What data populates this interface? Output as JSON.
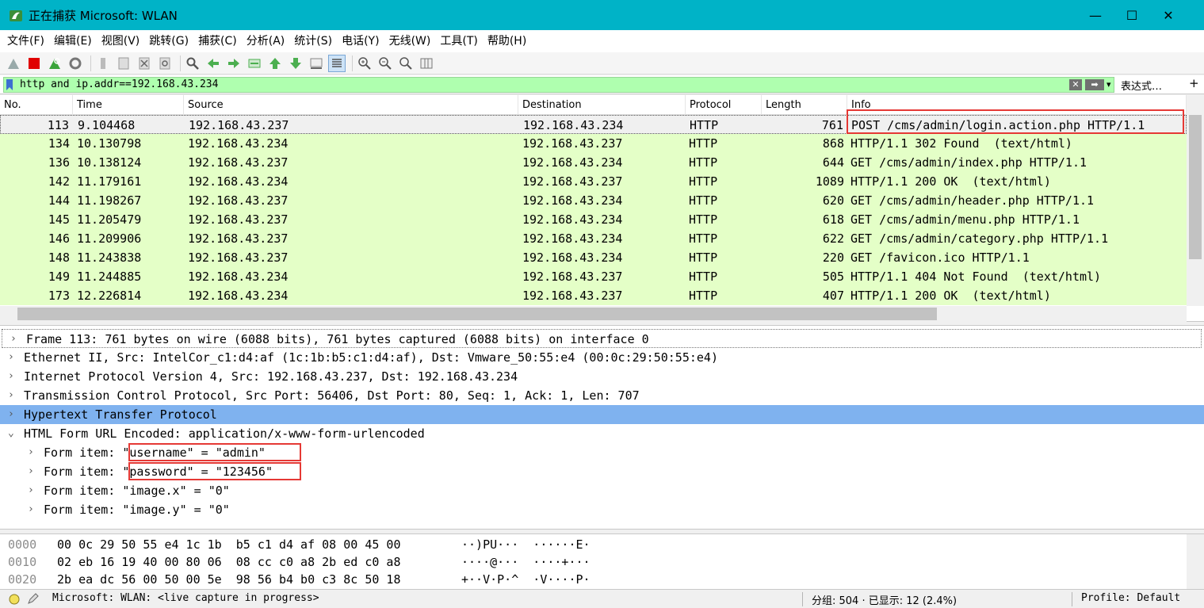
{
  "window": {
    "title": "正在捕获 Microsoft: WLAN",
    "minimize_glyph": "—",
    "maximize_glyph": "☐",
    "close_glyph": "✕"
  },
  "menu": {
    "items": [
      "文件(F)",
      "编辑(E)",
      "视图(V)",
      "跳转(G)",
      "捕获(C)",
      "分析(A)",
      "统计(S)",
      "电话(Y)",
      "无线(W)",
      "工具(T)",
      "帮助(H)"
    ]
  },
  "toolbar": {
    "icons": [
      "shark-fin-start-icon",
      "stop-capture-icon",
      "restart-capture-icon",
      "capture-options-icon",
      "open-file-icon",
      "save-file-icon",
      "close-file-icon",
      "reload-icon",
      "find-packet-icon",
      "go-back-icon",
      "go-forward-icon",
      "go-to-packet-icon",
      "first-packet-icon",
      "last-packet-icon",
      "autoscroll-icon",
      "colorize-icon",
      "zoom-in-icon",
      "zoom-out-icon",
      "normal-size-icon",
      "resize-columns-icon"
    ]
  },
  "filter": {
    "value": "http and ip.addr==192.168.43.234",
    "expression_label": "表达式…",
    "add_label": "+",
    "clear_glyph": "✕",
    "apply_glyph": "➡",
    "dropdown_glyph": "▾"
  },
  "packet_list": {
    "columns": [
      "No.",
      "Time",
      "Source",
      "Destination",
      "Protocol",
      "Length",
      "Info"
    ],
    "rows": [
      {
        "no": "113",
        "time": "9.104468",
        "src": "192.168.43.237",
        "dst": "192.168.43.234",
        "proto": "HTTP",
        "len": "761",
        "info": "POST /cms/admin/login.action.php HTTP/1.1",
        "selected": true
      },
      {
        "no": "134",
        "time": "10.130798",
        "src": "192.168.43.234",
        "dst": "192.168.43.237",
        "proto": "HTTP",
        "len": "868",
        "info": "HTTP/1.1 302 Found  (text/html)"
      },
      {
        "no": "136",
        "time": "10.138124",
        "src": "192.168.43.237",
        "dst": "192.168.43.234",
        "proto": "HTTP",
        "len": "644",
        "info": "GET /cms/admin/index.php HTTP/1.1"
      },
      {
        "no": "142",
        "time": "11.179161",
        "src": "192.168.43.234",
        "dst": "192.168.43.237",
        "proto": "HTTP",
        "len": "1089",
        "info": "HTTP/1.1 200 OK  (text/html)"
      },
      {
        "no": "144",
        "time": "11.198267",
        "src": "192.168.43.237",
        "dst": "192.168.43.234",
        "proto": "HTTP",
        "len": "620",
        "info": "GET /cms/admin/header.php HTTP/1.1"
      },
      {
        "no": "145",
        "time": "11.205479",
        "src": "192.168.43.237",
        "dst": "192.168.43.234",
        "proto": "HTTP",
        "len": "618",
        "info": "GET /cms/admin/menu.php HTTP/1.1"
      },
      {
        "no": "146",
        "time": "11.209906",
        "src": "192.168.43.237",
        "dst": "192.168.43.234",
        "proto": "HTTP",
        "len": "622",
        "info": "GET /cms/admin/category.php HTTP/1.1"
      },
      {
        "no": "148",
        "time": "11.243838",
        "src": "192.168.43.237",
        "dst": "192.168.43.234",
        "proto": "HTTP",
        "len": "220",
        "info": "GET /favicon.ico HTTP/1.1"
      },
      {
        "no": "149",
        "time": "11.244885",
        "src": "192.168.43.234",
        "dst": "192.168.43.237",
        "proto": "HTTP",
        "len": "505",
        "info": "HTTP/1.1 404 Not Found  (text/html)"
      },
      {
        "no": "173",
        "time": "12.226814",
        "src": "192.168.43.234",
        "dst": "192.168.43.237",
        "proto": "HTTP",
        "len": "407",
        "info": "HTTP/1.1 200 OK  (text/html)"
      }
    ]
  },
  "details": {
    "rows": [
      {
        "arrow": "›",
        "text": "Frame 113: 761 bytes on wire (6088 bits), 761 bytes captured (6088 bits) on interface 0",
        "indent": 0
      },
      {
        "arrow": "›",
        "text": "Ethernet II, Src: IntelCor_c1:d4:af (1c:1b:b5:c1:d4:af), Dst: Vmware_50:55:e4 (00:0c:29:50:55:e4)",
        "indent": 0
      },
      {
        "arrow": "›",
        "text": "Internet Protocol Version 4, Src: 192.168.43.237, Dst: 192.168.43.234",
        "indent": 0
      },
      {
        "arrow": "›",
        "text": "Transmission Control Protocol, Src Port: 56406, Dst Port: 80, Seq: 1, Ack: 1, Len: 707",
        "indent": 0
      },
      {
        "arrow": "›",
        "text": "Hypertext Transfer Protocol",
        "indent": 0,
        "selected": true
      },
      {
        "arrow": "⌄",
        "text": "HTML Form URL Encoded: application/x-www-form-urlencoded",
        "indent": 0
      },
      {
        "arrow": "›",
        "text": "Form item: \"username\" = \"admin\"",
        "indent": 1
      },
      {
        "arrow": "›",
        "text": "Form item: \"password\" = \"123456\"",
        "indent": 1
      },
      {
        "arrow": "›",
        "text": "Form item: \"image.x\" = \"0\"",
        "indent": 1
      },
      {
        "arrow": "›",
        "text": "Form item: \"image.y\" = \"0\"",
        "indent": 1
      }
    ]
  },
  "bytes": {
    "rows": [
      {
        "offset": "0000",
        "hex": "00 0c 29 50 55 e4 1c 1b  b5 c1 d4 af 08 00 45 00",
        "ascii": "··)PU···  ······E·"
      },
      {
        "offset": "0010",
        "hex": "02 eb 16 19 40 00 80 06  08 cc c0 a8 2b ed c0 a8",
        "ascii": "····@···  ····+···"
      },
      {
        "offset": "0020",
        "hex": "2b ea dc 56 00 50 00 5e  98 56 b4 b0 c3 8c 50 18",
        "ascii": "+··V·P·^  ·V····P·"
      }
    ]
  },
  "status": {
    "interface": "Microsoft: WLAN: <live capture in progress>",
    "packets": "分组: 504 · 已显示: 12 (2.4%)",
    "profile": "Profile: Default"
  },
  "colors": {
    "titlebar": "#00b3c7",
    "row_http": "#e4ffc7",
    "filter_ok": "#afffaf",
    "tree_selected": "#7fb2ef",
    "annotation": "#e53935"
  }
}
